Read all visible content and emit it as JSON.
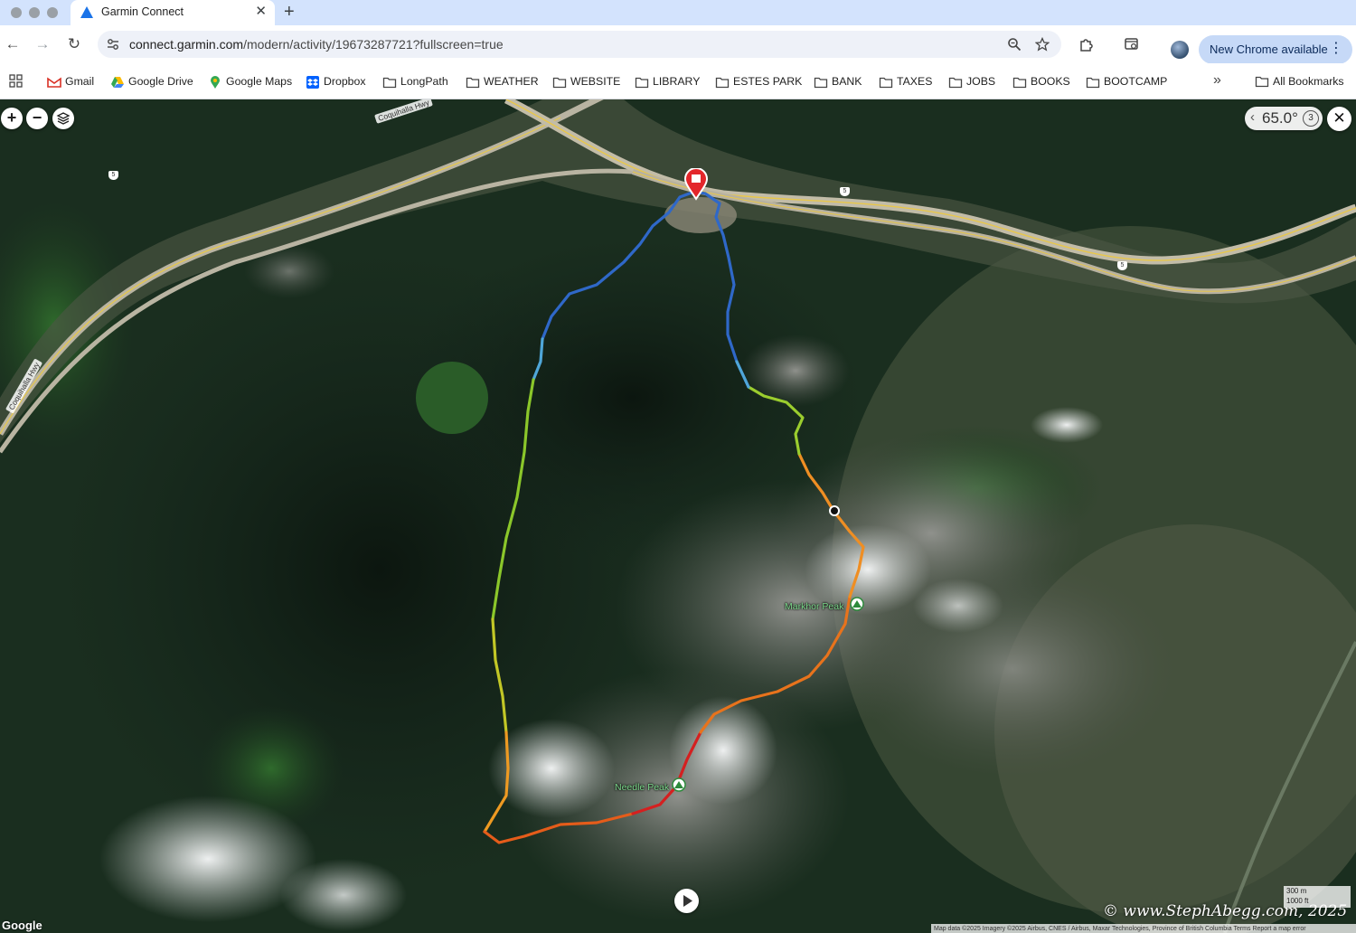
{
  "browser": {
    "tab": {
      "title": "Garmin Connect"
    },
    "address": {
      "host": "connect.garmin.com",
      "path": "/modern/activity/19673287721?fullscreen=true"
    },
    "update_button": "New Chrome available",
    "bookmarks": [
      {
        "label": "Gmail",
        "icon": "gmail-icon"
      },
      {
        "label": "Google Drive",
        "icon": "google-drive-icon"
      },
      {
        "label": "Google Maps",
        "icon": "google-maps-icon"
      },
      {
        "label": "Dropbox",
        "icon": "dropbox-icon"
      },
      {
        "label": "LongPath",
        "icon": "folder-icon"
      },
      {
        "label": "WEATHER",
        "icon": "folder-icon"
      },
      {
        "label": "WEBSITE",
        "icon": "folder-icon"
      },
      {
        "label": "LIBRARY",
        "icon": "folder-icon"
      },
      {
        "label": "ESTES PARK",
        "icon": "folder-icon"
      },
      {
        "label": "BANK",
        "icon": "folder-icon"
      },
      {
        "label": "TAXES",
        "icon": "folder-icon"
      },
      {
        "label": "JOBS",
        "icon": "folder-icon"
      },
      {
        "label": "BOOKS",
        "icon": "folder-icon"
      },
      {
        "label": "BOOTCAMP",
        "icon": "folder-icon"
      }
    ],
    "all_bookmarks": "All Bookmarks"
  },
  "map": {
    "tilt_value": "65.0°",
    "tilt_step": "3",
    "highway_labels": [
      "Coquihalla Hwy",
      "Coquihalla Hwy"
    ],
    "route_shields": [
      "5",
      "5",
      "5"
    ],
    "peaks": [
      {
        "name": "Markhor Peak"
      },
      {
        "name": "Needle Peak"
      }
    ],
    "scale": {
      "metric": "300 m",
      "imperial": "1000 ft"
    },
    "google_logo": "Google",
    "watermark": "© www.StephAbegg.com, 2025",
    "attribution": "Map data ©2025 Imagery ©2025 Airbus, CNES / Airbus, Maxar Technologies, Province of British Columbia   Terms   Report a map error",
    "colors": {
      "route_low": "#1f5fbf",
      "route_mid": "#8ccf2a",
      "route_high": "#e8731c",
      "route_peak": "#d41e1e",
      "start_pin": "#e3262b"
    }
  }
}
